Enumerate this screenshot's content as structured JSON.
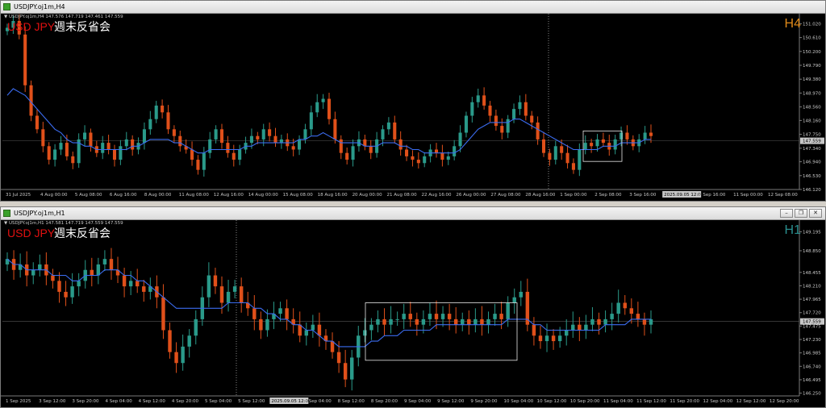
{
  "colors": {
    "bull": "#2a9a8a",
    "bear": "#e0501a",
    "ma": "#3b6cf0",
    "grid": "#555555",
    "axis_text": "#c8c8c8",
    "symbol": "#e01010",
    "tf_h4": "#e08a1a",
    "tf_h1": "#2a8f8f"
  },
  "window_top": {
    "title": "USDJPY.oj1m,H4",
    "info_line": "▼ USDJPY.oj1m,H4  147.576 147.719 147.461 147.559",
    "symbol_label": "USD JPY",
    "jp_label": "週末反省会",
    "timeframe": "H4",
    "price_labels": [
      "151.020",
      "150.610",
      "150.200",
      "149.790",
      "149.380",
      "148.970",
      "148.560",
      "148.160",
      "147.750",
      "147.559",
      "147.340",
      "146.940",
      "146.530",
      "146.120"
    ],
    "current_price": "147.559",
    "time_labels": [
      "31 Jul 2025",
      "4 Aug 00:00",
      "5 Aug 08:00",
      "6 Aug 16:00",
      "8 Aug 00:00",
      "11 Aug 08:00",
      "12 Aug 16:00",
      "14 Aug 00:00",
      "15 Aug 08:00",
      "18 Aug 16:00",
      "20 Aug 00:00",
      "21 Aug 08:00",
      "22 Aug 16:00",
      "26 Aug 00:00",
      "27 Aug 08:00",
      "28 Aug 16:00",
      "1 Sep 00:00",
      "2 Sep 08:00",
      "3 Sep 16:00",
      "2025.09.05 12:00",
      "9 Sep 16:00",
      "11 Sep 00:00",
      "12 Sep 08:00"
    ],
    "highlight_time": "2025.09.05 12:00"
  },
  "window_bottom": {
    "title": "USDJPY.oj1m,H1",
    "info_line": "▼ USDJPY.oj1m,H1  147.581 147.719 147.559 147.559",
    "symbol_label": "USD JPY",
    "jp_label": "週末反省会",
    "timeframe": "H1",
    "price_labels": [
      "149.195",
      "148.850",
      "148.455",
      "148.210",
      "147.965",
      "147.720",
      "147.559",
      "147.475",
      "147.230",
      "146.985",
      "146.740",
      "146.495",
      "146.250"
    ],
    "current_price": "147.559",
    "time_labels": [
      "1 Sep 2025",
      "3 Sep 12:00",
      "3 Sep 20:00",
      "4 Sep 04:00",
      "4 Sep 12:00",
      "4 Sep 20:00",
      "5 Sep 04:00",
      "5 Sep 12:00",
      "2025.09.05 12:00",
      "8 Sep 04:00",
      "8 Sep 12:00",
      "8 Sep 20:00",
      "9 Sep 04:00",
      "9 Sep 12:00",
      "9 Sep 20:00",
      "10 Sep 04:00",
      "10 Sep 12:00",
      "10 Sep 20:00",
      "11 Sep 04:00",
      "11 Sep 12:00",
      "11 Sep 20:00",
      "12 Sep 04:00",
      "12 Sep 12:00",
      "12 Sep 20:00"
    ],
    "highlight_time": "2025.09.05 12:00"
  },
  "window_buttons": {
    "minimize": "–",
    "restore": "❐",
    "close": "✕"
  },
  "chart_data": [
    {
      "type": "candlestick",
      "title": "USDJPY.oj1m,H4",
      "ylim": [
        146.12,
        151.22
      ],
      "close_series": [
        150.9,
        151.1,
        150.7,
        149.2,
        148.3,
        147.9,
        147.4,
        147.0,
        147.3,
        147.5,
        147.1,
        146.9,
        147.6,
        147.8,
        147.4,
        147.2,
        147.5,
        147.3,
        147.0,
        147.4,
        147.6,
        147.3,
        147.5,
        147.9,
        148.2,
        148.6,
        148.4,
        147.9,
        147.7,
        147.4,
        147.3,
        147.0,
        146.7,
        147.2,
        147.6,
        147.9,
        147.5,
        147.2,
        147.0,
        147.3,
        147.5,
        147.7,
        147.6,
        147.9,
        147.7,
        147.5,
        147.6,
        147.4,
        147.3,
        147.6,
        147.9,
        148.4,
        148.7,
        148.8,
        148.2,
        147.6,
        147.2,
        147.0,
        147.4,
        147.6,
        147.4,
        147.2,
        147.6,
        147.9,
        148.1,
        147.6,
        147.3,
        147.1,
        147.0,
        146.9,
        147.1,
        147.3,
        147.2,
        147.0,
        147.1,
        147.4,
        147.8,
        148.3,
        148.7,
        148.9,
        148.6,
        148.3,
        148.0,
        147.8,
        148.2,
        148.5,
        148.7,
        148.3,
        148.1,
        147.6,
        147.2,
        147.0,
        147.4,
        147.2,
        146.9,
        146.7,
        147.3,
        147.5,
        147.4,
        147.6,
        147.5,
        147.3,
        147.6,
        147.8,
        147.6,
        147.4,
        147.6,
        147.8,
        147.7
      ],
      "ma_series": [
        148.9,
        149.1,
        149.0,
        148.9,
        148.7,
        148.5,
        148.3,
        148.1,
        147.9,
        147.8,
        147.6,
        147.5,
        147.5,
        147.4,
        147.4,
        147.3,
        147.3,
        147.3,
        147.3,
        147.3,
        147.3,
        147.4,
        147.4,
        147.5,
        147.6,
        147.6,
        147.6,
        147.6,
        147.5,
        147.5,
        147.4,
        147.3,
        147.2,
        147.2,
        147.3,
        147.3,
        147.3,
        147.3,
        147.3,
        147.3,
        147.4,
        147.4,
        147.5,
        147.5,
        147.5,
        147.5,
        147.5,
        147.5,
        147.5,
        147.6,
        147.6,
        147.7,
        147.7,
        147.8,
        147.7,
        147.6,
        147.5,
        147.5,
        147.5,
        147.5,
        147.4,
        147.4,
        147.4,
        147.5,
        147.5,
        147.5,
        147.4,
        147.4,
        147.3,
        147.3,
        147.2,
        147.2,
        147.2,
        147.2,
        147.2,
        147.2,
        147.3,
        147.5,
        147.7,
        147.9,
        148.0,
        148.1,
        148.1,
        148.1,
        148.1,
        148.2,
        148.2,
        148.1,
        148.0,
        147.9,
        147.8,
        147.7,
        147.6,
        147.5,
        147.4,
        147.3,
        147.3,
        147.3,
        147.3,
        147.3,
        147.4,
        147.4,
        147.4,
        147.5,
        147.5,
        147.5,
        147.5,
        147.6,
        147.6
      ]
    },
    {
      "type": "candlestick",
      "title": "USDJPY.oj1m,H1",
      "ylim": [
        146.2,
        149.35
      ],
      "close_series": [
        148.7,
        148.5,
        148.6,
        148.4,
        148.5,
        148.6,
        148.4,
        148.3,
        148.1,
        148.0,
        148.2,
        148.3,
        148.5,
        148.4,
        148.6,
        148.7,
        148.5,
        148.4,
        148.2,
        148.3,
        148.2,
        148.1,
        148.2,
        148.0,
        147.4,
        147.0,
        146.8,
        147.1,
        147.3,
        147.6,
        148.0,
        148.4,
        148.2,
        147.9,
        148.1,
        148.2,
        147.9,
        147.8,
        147.6,
        147.4,
        147.6,
        147.7,
        147.8,
        147.6,
        147.5,
        147.3,
        147.4,
        147.5,
        147.3,
        147.2,
        147.0,
        146.8,
        146.5,
        146.9,
        147.3,
        147.4,
        147.5,
        147.6,
        147.5,
        147.6,
        147.6,
        147.7,
        147.6,
        147.5,
        147.6,
        147.7,
        147.6,
        147.7,
        147.6,
        147.5,
        147.6,
        147.5,
        147.6,
        147.5,
        147.6,
        147.7,
        147.6,
        147.9,
        148.0,
        148.1,
        147.5,
        147.3,
        147.2,
        147.3,
        147.2,
        147.3,
        147.4,
        147.5,
        147.4,
        147.5,
        147.6,
        147.5,
        147.6,
        147.7,
        147.9,
        147.8,
        147.7,
        147.6,
        147.5,
        147.6
      ],
      "ma_series": [
        148.7,
        148.6,
        148.6,
        148.5,
        148.5,
        148.5,
        148.5,
        148.4,
        148.4,
        148.4,
        148.3,
        148.3,
        148.4,
        148.4,
        148.4,
        148.5,
        148.5,
        148.5,
        148.4,
        148.4,
        148.3,
        148.3,
        148.2,
        148.1,
        148.0,
        147.9,
        147.8,
        147.8,
        147.8,
        147.8,
        147.8,
        147.8,
        147.8,
        147.8,
        147.9,
        147.9,
        147.9,
        147.9,
        147.8,
        147.8,
        147.7,
        147.7,
        147.6,
        147.6,
        147.5,
        147.5,
        147.4,
        147.4,
        147.3,
        147.2,
        147.2,
        147.1,
        147.1,
        147.1,
        147.1,
        147.1,
        147.2,
        147.2,
        147.3,
        147.3,
        147.3,
        147.4,
        147.4,
        147.4,
        147.4,
        147.4,
        147.5,
        147.5,
        147.5,
        147.5,
        147.5,
        147.5,
        147.5,
        147.5,
        147.5,
        147.5,
        147.5,
        147.6,
        147.6,
        147.6,
        147.6,
        147.5,
        147.5,
        147.4,
        147.4,
        147.4,
        147.4,
        147.4,
        147.4,
        147.4,
        147.4,
        147.4,
        147.5,
        147.5,
        147.5,
        147.5,
        147.6,
        147.6,
        147.6,
        147.6
      ]
    }
  ]
}
